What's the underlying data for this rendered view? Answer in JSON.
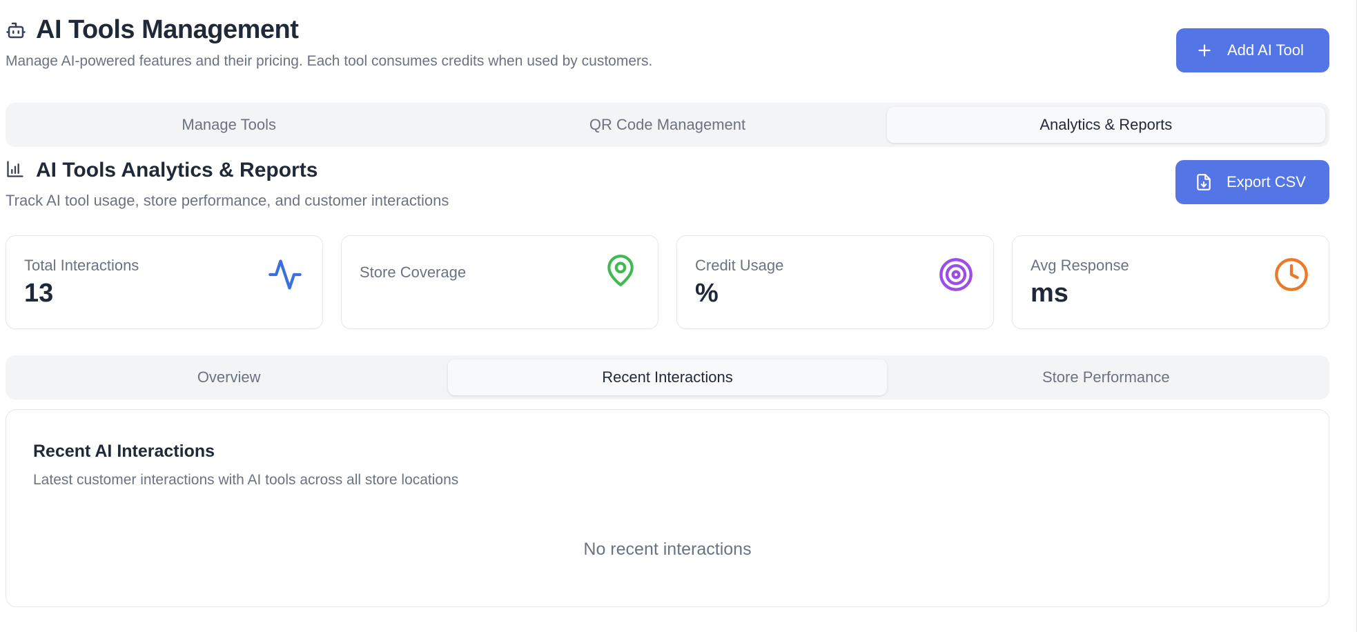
{
  "header": {
    "title": "AI Tools Management",
    "subtitle": "Manage AI-powered features and their pricing. Each tool consumes credits when used by customers.",
    "add_button_label": "Add AI Tool"
  },
  "main_tabs": [
    {
      "label": "Manage Tools",
      "active": false
    },
    {
      "label": "QR Code Management",
      "active": false
    },
    {
      "label": "Analytics & Reports",
      "active": true
    }
  ],
  "analytics": {
    "title": "AI Tools Analytics & Reports",
    "subtitle": "Track AI tool usage, store performance, and customer interactions",
    "export_button_label": "Export CSV"
  },
  "stats": [
    {
      "label": "Total Interactions",
      "value": "13",
      "icon": "activity-icon",
      "color": "#3b6fe0"
    },
    {
      "label": "Store Coverage",
      "value": "",
      "icon": "map-pin-icon",
      "color": "#3fb950"
    },
    {
      "label": "Credit Usage",
      "value": "%",
      "icon": "target-icon",
      "color": "#9b4de8"
    },
    {
      "label": "Avg Response",
      "value": "ms",
      "icon": "clock-icon",
      "color": "#ea7a2a"
    }
  ],
  "sub_tabs": [
    {
      "label": "Overview",
      "active": false
    },
    {
      "label": "Recent Interactions",
      "active": true
    },
    {
      "label": "Store Performance",
      "active": false
    }
  ],
  "recent": {
    "title": "Recent AI Interactions",
    "subtitle": "Latest customer interactions with AI tools across all store locations",
    "empty_text": "No recent interactions"
  },
  "colors": {
    "primary": "#5475e6",
    "muted_text": "#6b7280",
    "heading_text": "#1f2937"
  }
}
